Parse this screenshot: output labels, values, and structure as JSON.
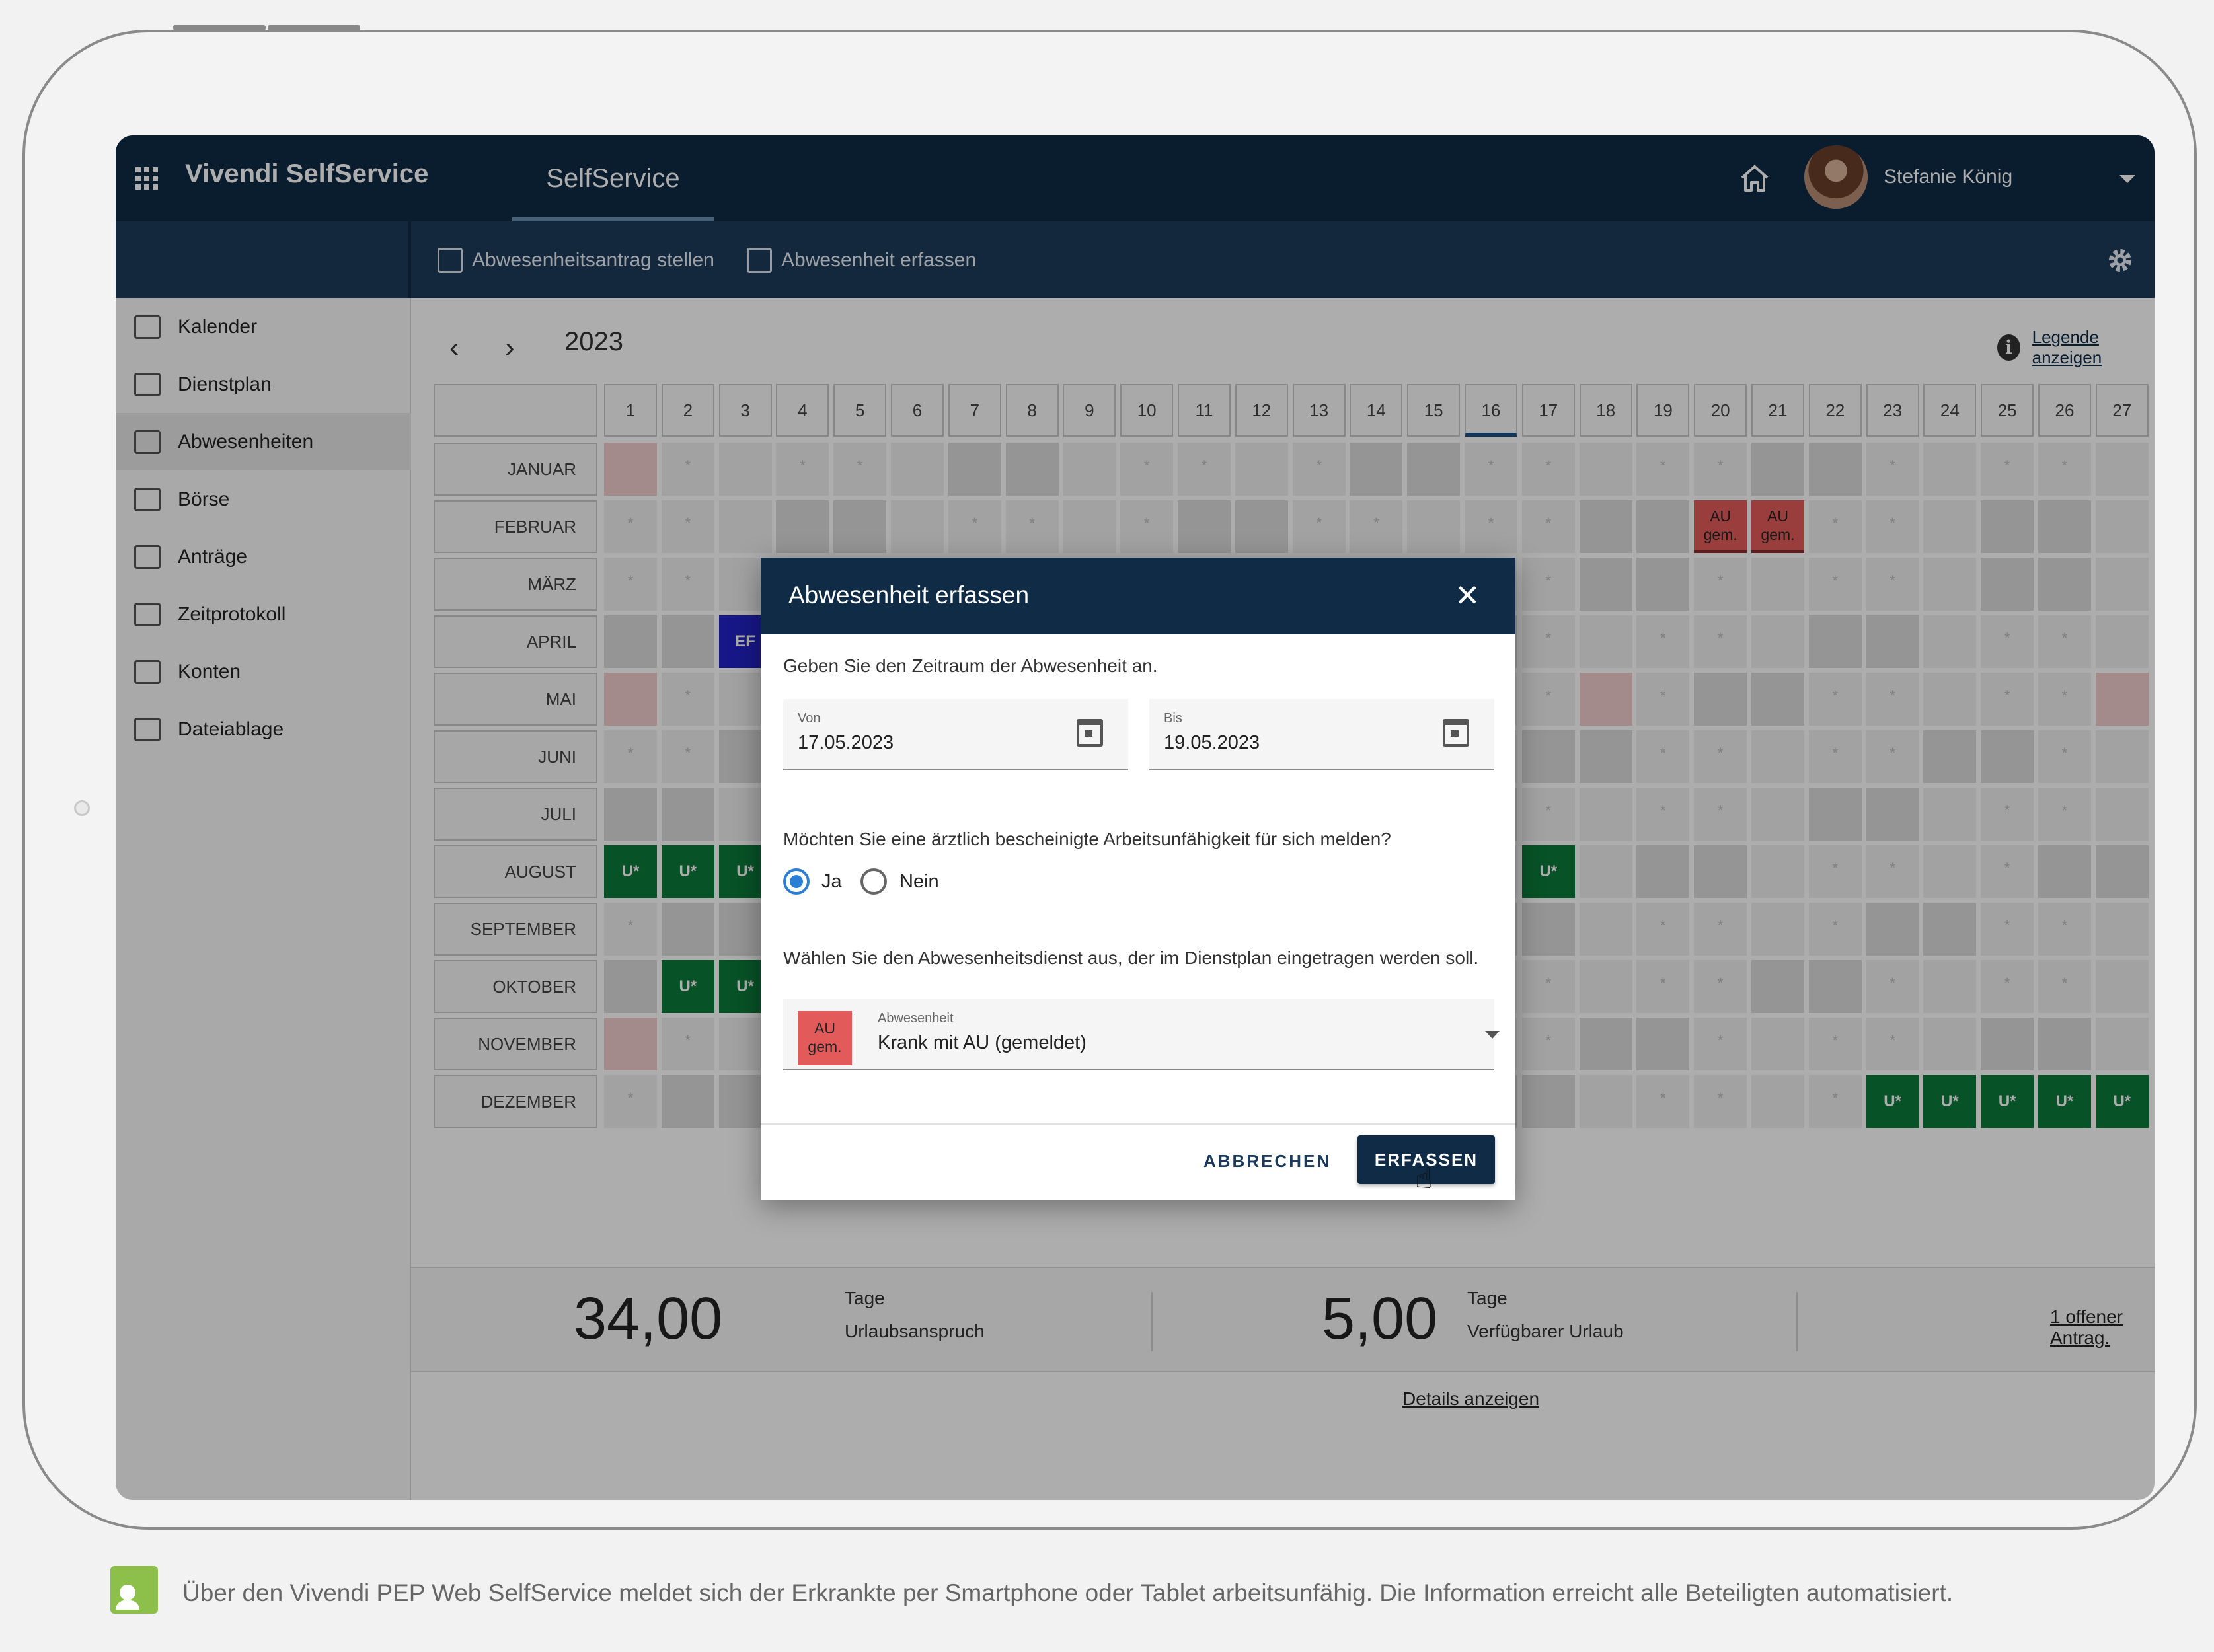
{
  "app": {
    "title": "Vivendi SelfService",
    "tab": "SelfService",
    "user_name": "Stefanie König"
  },
  "toolbar": {
    "request_label": "Abwesenheitsantrag stellen",
    "record_label": "Abwesenheit erfassen"
  },
  "sidebar": {
    "items": [
      {
        "label": "Kalender",
        "icon": "calendar-columns-icon"
      },
      {
        "label": "Dienstplan",
        "icon": "grid-icon"
      },
      {
        "label": "Abwesenheiten",
        "icon": "palm-tree-icon"
      },
      {
        "label": "Börse",
        "icon": "swap-arrows-icon"
      },
      {
        "label": "Anträge",
        "icon": "clipboard-icon"
      },
      {
        "label": "Zeitprotokoll",
        "icon": "clipboard-clock-icon"
      },
      {
        "label": "Konten",
        "icon": "bank-icon"
      },
      {
        "label": "Dateiablage",
        "icon": "files-icon"
      }
    ],
    "active": "Abwesenheiten"
  },
  "calendar": {
    "year": "2023",
    "legend_link": "Legende anzeigen",
    "days": [
      "1",
      "2",
      "3",
      "4",
      "5",
      "6",
      "7",
      "8",
      "9",
      "10",
      "11",
      "12",
      "13",
      "14",
      "15",
      "16",
      "17",
      "18",
      "19",
      "20",
      "21",
      "22",
      "23",
      "24",
      "25",
      "26",
      "27"
    ],
    "current_day": "16",
    "months": [
      "JANUAR",
      "FEBRUAR",
      "MÄRZ",
      "APRIL",
      "MAI",
      "JUNI",
      "JULI",
      "AUGUST",
      "SEPTEMBER",
      "OKTOBER",
      "NOVEMBER",
      "DEZEMBER"
    ],
    "markers": {
      "vacation": "U*",
      "sick_line1": "AU",
      "sick_line2": "gem.",
      "ef": "EF"
    }
  },
  "summary": {
    "entitlement_value": "34,00",
    "entitlement_unit": "Tage",
    "entitlement_label": "Urlaubsanspruch",
    "available_value": "5,00",
    "available_unit": "Tage",
    "available_label": "Verfügbarer Urlaub",
    "open_request": "1 offener Antrag.",
    "details_link": "Details anzeigen"
  },
  "dialog": {
    "title": "Abwesenheit erfassen",
    "period_prompt": "Geben Sie den Zeitraum der Abwesenheit an.",
    "from_label": "Von",
    "from_value": "17.05.2023",
    "to_label": "Bis",
    "to_value": "19.05.2023",
    "au_question": "Möchten Sie eine ärztlich bescheinigte Arbeitsunfähigkeit für sich melden?",
    "yes_label": "Ja",
    "no_label": "Nein",
    "selected": "Ja",
    "service_prompt": "Wählen Sie den Abwesenheitsdienst aus, der im Dienstplan eingetragen werden soll.",
    "select_label": "Abwesenheit",
    "select_value": "Krank mit AU (gemeldet)",
    "badge_line1": "AU",
    "badge_line2": "gem.",
    "cancel_label": "ABBRECHEN",
    "submit_label": "ERFASSEN"
  },
  "caption": "Über den Vivendi PEP Web SelfService meldet sich der Erkrankte per Smartphone oder Tablet arbeitsunfähig. Die Information erreicht alle Beteiligten automatisiert.",
  "colors": {
    "header": "#0f2b46",
    "toolbar": "#1c3a5a",
    "vacation": "#0c7a3a",
    "sick": "#e35a5a",
    "radio_accent": "#2a7fd4",
    "caption_icon": "#8cc04a"
  }
}
